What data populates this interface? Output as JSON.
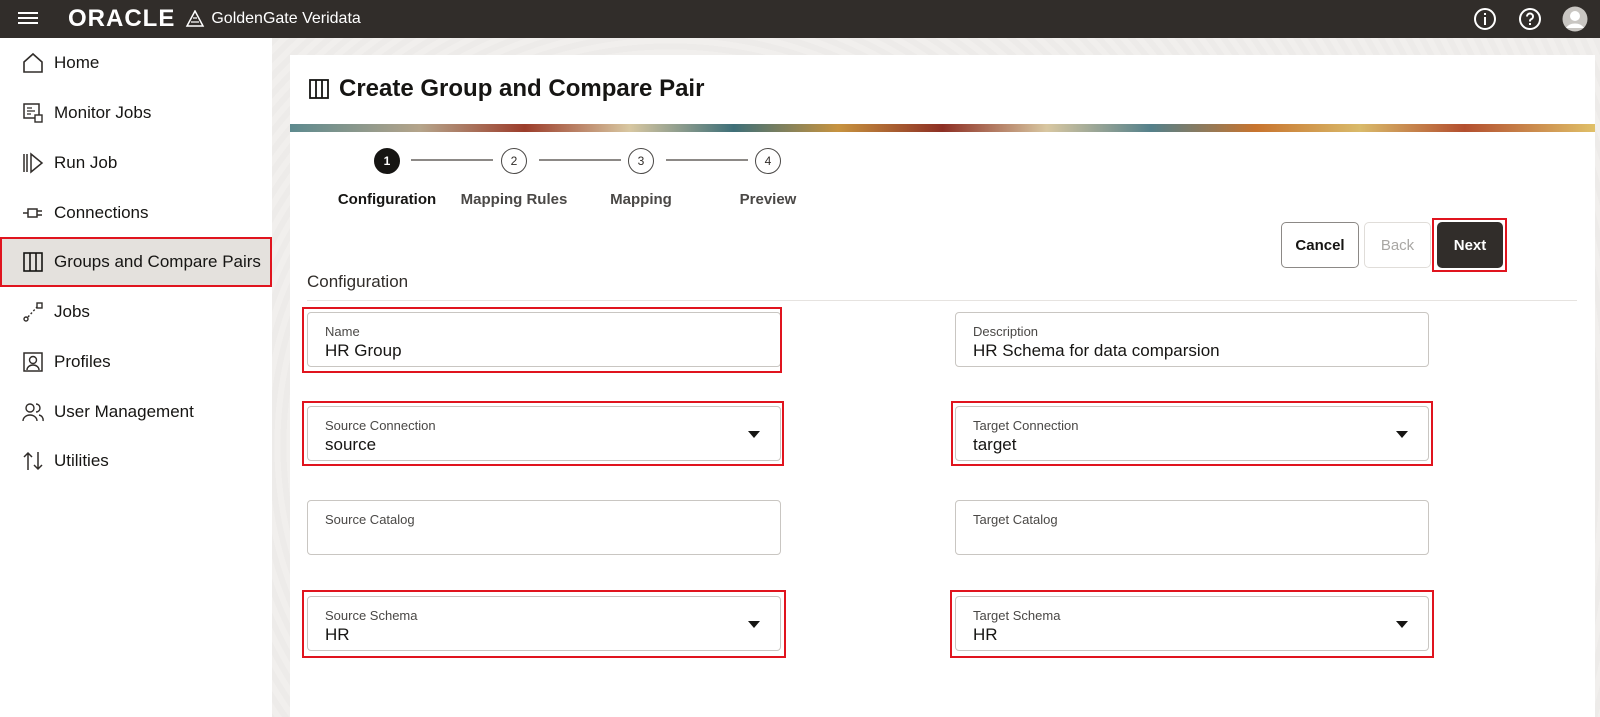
{
  "header": {
    "brand": "ORACLE",
    "product": "GoldenGate Veridata"
  },
  "sidebar": {
    "items": [
      {
        "label": "Home",
        "icon": "home-icon"
      },
      {
        "label": "Monitor Jobs",
        "icon": "monitor-jobs-icon"
      },
      {
        "label": "Run Job",
        "icon": "run-job-icon"
      },
      {
        "label": "Connections",
        "icon": "plug-icon"
      },
      {
        "label": "Groups and Compare Pairs",
        "icon": "columns-icon",
        "active": true
      },
      {
        "label": "Jobs",
        "icon": "jobs-icon"
      },
      {
        "label": "Profiles",
        "icon": "profile-icon"
      },
      {
        "label": "User Management",
        "icon": "users-icon"
      },
      {
        "label": "Utilities",
        "icon": "utilities-icon"
      }
    ]
  },
  "page": {
    "title": "Create Group and Compare Pair"
  },
  "steps": [
    {
      "number": "1",
      "label": "Configuration",
      "current": true
    },
    {
      "number": "2",
      "label": "Mapping Rules"
    },
    {
      "number": "3",
      "label": "Mapping"
    },
    {
      "number": "4",
      "label": "Preview"
    }
  ],
  "buttons": {
    "cancel": "Cancel",
    "back": "Back",
    "next": "Next"
  },
  "section": {
    "title": "Configuration"
  },
  "form": {
    "name": {
      "label": "Name",
      "value": "HR Group"
    },
    "description": {
      "label": "Description",
      "value": "HR Schema for data comparsion"
    },
    "source_connection": {
      "label": "Source Connection",
      "value": "source"
    },
    "target_connection": {
      "label": "Target Connection",
      "value": "target"
    },
    "source_catalog": {
      "label": "Source Catalog",
      "value": ""
    },
    "target_catalog": {
      "label": "Target Catalog",
      "value": ""
    },
    "source_schema": {
      "label": "Source Schema",
      "value": "HR"
    },
    "target_schema": {
      "label": "Target Schema",
      "value": "HR"
    }
  },
  "colors": {
    "topbar": "#312d2a",
    "highlight": "#e0141e",
    "primary_button": "#312d2a"
  }
}
